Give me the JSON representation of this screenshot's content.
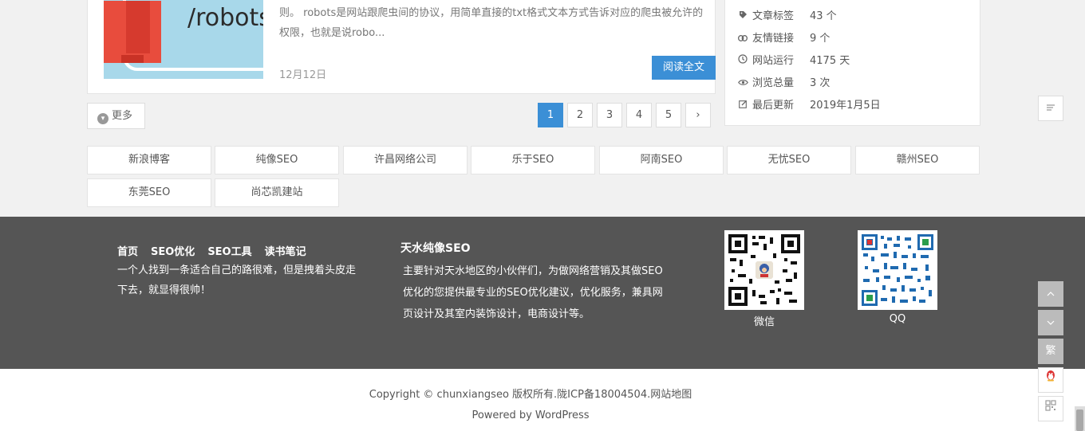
{
  "post": {
    "thumb_text": "/robots",
    "excerpt": "则。 robots是网站跟爬虫间的协议，用简单直接的txt格式文本方式告诉对应的爬虫被允许的权限，也就是说robo...",
    "date": "12月12日",
    "read_more": "阅读全文"
  },
  "more_label": "更多",
  "pagination": {
    "pages": [
      "1",
      "2",
      "3",
      "4",
      "5"
    ],
    "active": "1",
    "next": "›"
  },
  "stats": [
    {
      "icon": "tag-icon",
      "label": "文章标签",
      "value": "43 个"
    },
    {
      "icon": "link-icon",
      "label": "友情链接",
      "value": "9 个"
    },
    {
      "icon": "clock-icon",
      "label": "网站运行",
      "value": "4175 天"
    },
    {
      "icon": "eye-icon",
      "label": "浏览总量",
      "value": "3 次"
    },
    {
      "icon": "edit-icon",
      "label": "最后更新",
      "value": "2019年1月5日"
    }
  ],
  "links": [
    "新浪博客",
    "纯像SEO",
    "许昌网络公司",
    "乐于SEO",
    "阿南SEO",
    "无忧SEO",
    "赣州SEO",
    "东莞SEO",
    "尚芯凯建站"
  ],
  "footer": {
    "nav": [
      "首页",
      "SEO优化",
      "SEO工具",
      "读书笔记"
    ],
    "slogan": "一个人找到一条适合自己的路很难，但是拽着头皮走下去，就显得很帅！",
    "about_title": "天水纯像SEO",
    "about_text": "主要针对天水地区的小伙伴们，为做网络营销及其做SEO优化的您提供最专业的SEO优化建议，优化服务，兼具网页设计及其室内装饰设计，电商设计等。",
    "qr_wechat_label": "微信",
    "qr_qq_label": "QQ",
    "copyright": "Copyright © chunxiangseo 版权所有.陇ICP备18004504.网站地图",
    "powered": "Powered by WordPress"
  },
  "float": {
    "traditional": "繁"
  },
  "colors": {
    "accent": "#3b8fd6",
    "footer_bg": "#555555"
  }
}
